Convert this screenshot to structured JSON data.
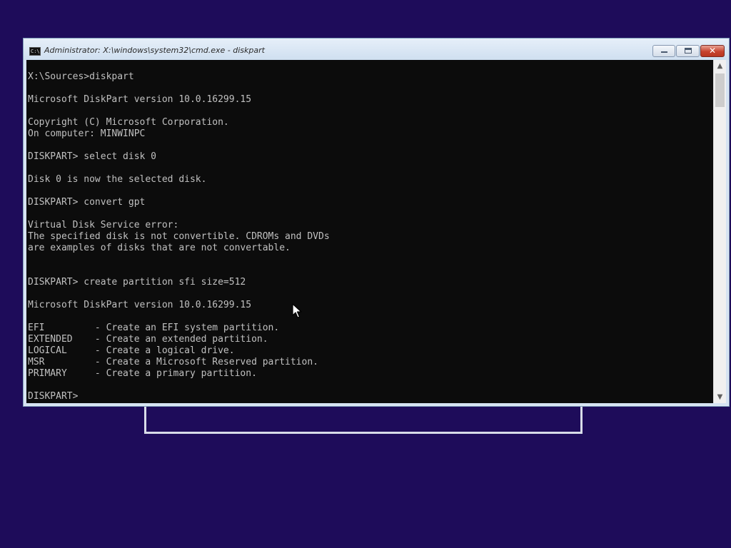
{
  "window": {
    "title": "Administrator: X:\\windows\\system32\\cmd.exe - diskpart",
    "icon": "console-icon",
    "icon_text": "C:\\",
    "buttons": {
      "minimize": "minimize-icon",
      "maximize": "maximize-icon",
      "close": "close-icon",
      "close_glyph": "✕"
    }
  },
  "console": {
    "lines": [
      "X:\\Sources>diskpart",
      "",
      "Microsoft DiskPart version 10.0.16299.15",
      "",
      "Copyright (C) Microsoft Corporation.",
      "On computer: MINWINPC",
      "",
      "DISKPART> select disk 0",
      "",
      "Disk 0 is now the selected disk.",
      "",
      "DISKPART> convert gpt",
      "",
      "Virtual Disk Service error:",
      "The specified disk is not convertible. CDROMs and DVDs",
      "are examples of disks that are not convertable.",
      "",
      "",
      "DISKPART> create partition sfi size=512",
      "",
      "Microsoft DiskPart version 10.0.16299.15",
      "",
      "EFI         - Create an EFI system partition.",
      "EXTENDED    - Create an extended partition.",
      "LOGICAL     - Create a logical drive.",
      "MSR         - Create a Microsoft Reserved partition.",
      "PRIMARY     - Create a primary partition.",
      "",
      "DISKPART> "
    ]
  },
  "scrollbar": {
    "up_arrow": "▲",
    "down_arrow": "▼"
  },
  "colors": {
    "desktop_background": "#1e0c5a",
    "console_background": "#0c0c0c",
    "console_text": "#c0c0c0",
    "close_button": "#c7432e"
  }
}
